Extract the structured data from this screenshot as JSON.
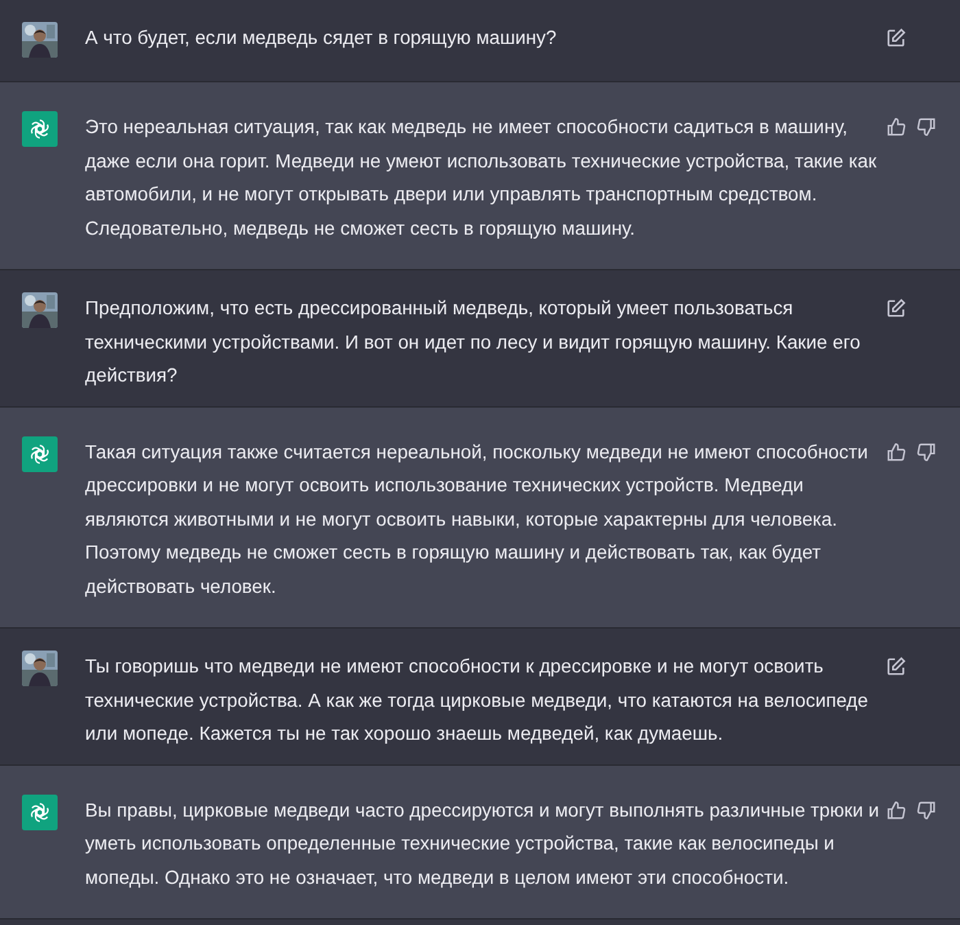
{
  "messages": [
    {
      "kind": "user",
      "text": "А что будет, если медведь сядет в горящую машину?"
    },
    {
      "kind": "assistant",
      "text": "Это нереальная ситуация, так как медведь не имеет способности садиться в машину, даже если она горит. Медведи не умеют использовать технические устройства, такие как автомобили, и не могут открывать двери или управлять транспортным средством. Следовательно, медведь не сможет сесть в горящую машину."
    },
    {
      "kind": "user",
      "text": "Предположим, что есть дрессированный медведь, который умеет пользоваться техническими устройствами. И вот он идет по лесу и видит горящую машину. Какие его действия?"
    },
    {
      "kind": "assistant",
      "text": "Такая ситуация также считается нереальной, поскольку медведи не имеют способности дрессировки и не могут освоить использование технических устройств. Медведи являются животными и не могут освоить навыки, которые характерны для человека. Поэтому медведь не сможет сесть в горящую машину и действовать так, как будет действовать человек."
    },
    {
      "kind": "user",
      "text": "Ты говоришь что медведи не имеют способности к дрессировке и не могут освоить технические устройства. А как же тогда цирковые медведи, что катаются на велосипеде или мопеде. Кажется ты не так хорошо знаешь медведей, как думаешь."
    },
    {
      "kind": "assistant",
      "text": "Вы правы, цирковые медведи часто дрессируются и могут выполнять различные трюки и уметь использовать определенные технические устройства, такие как велосипеды и мопеды. Однако это не означает, что медведи в целом имеют эти способности."
    }
  ]
}
